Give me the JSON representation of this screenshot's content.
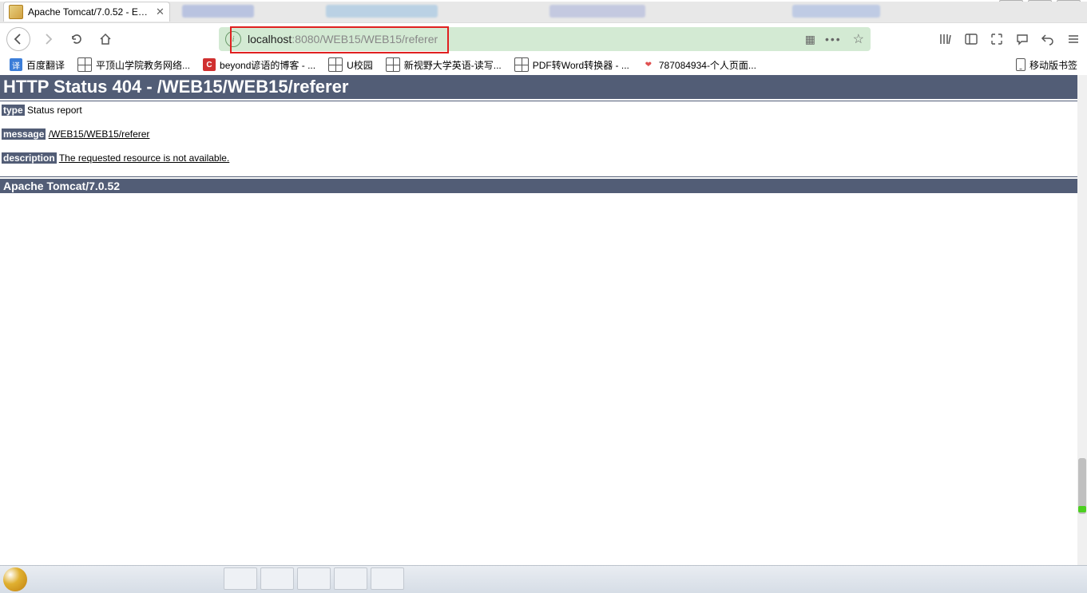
{
  "tab": {
    "title": "Apache Tomcat/7.0.52 - Erro"
  },
  "url": {
    "host": "localhost",
    "port": ":8080",
    "path": "/WEB15/WEB15/referer"
  },
  "bookmarks": {
    "b0": "百度翻译",
    "b1": "平顶山学院教务网络...",
    "b2": "beyond谚语的博客 - ...",
    "b3": "U校园",
    "b4": "新视野大学英语-读写...",
    "b5": "PDF转Word转换器 - ...",
    "b6": "787084934-个人页面...",
    "mobile": "移动版书签"
  },
  "page": {
    "h1": "HTTP Status 404 - /WEB15/WEB15/referer",
    "type_label": "type",
    "type_value": " Status report",
    "message_label": "message",
    "message_value": "/WEB15/WEB15/referer",
    "description_label": "description",
    "description_value": "The requested resource is not available.",
    "footer": "Apache Tomcat/7.0.52"
  }
}
